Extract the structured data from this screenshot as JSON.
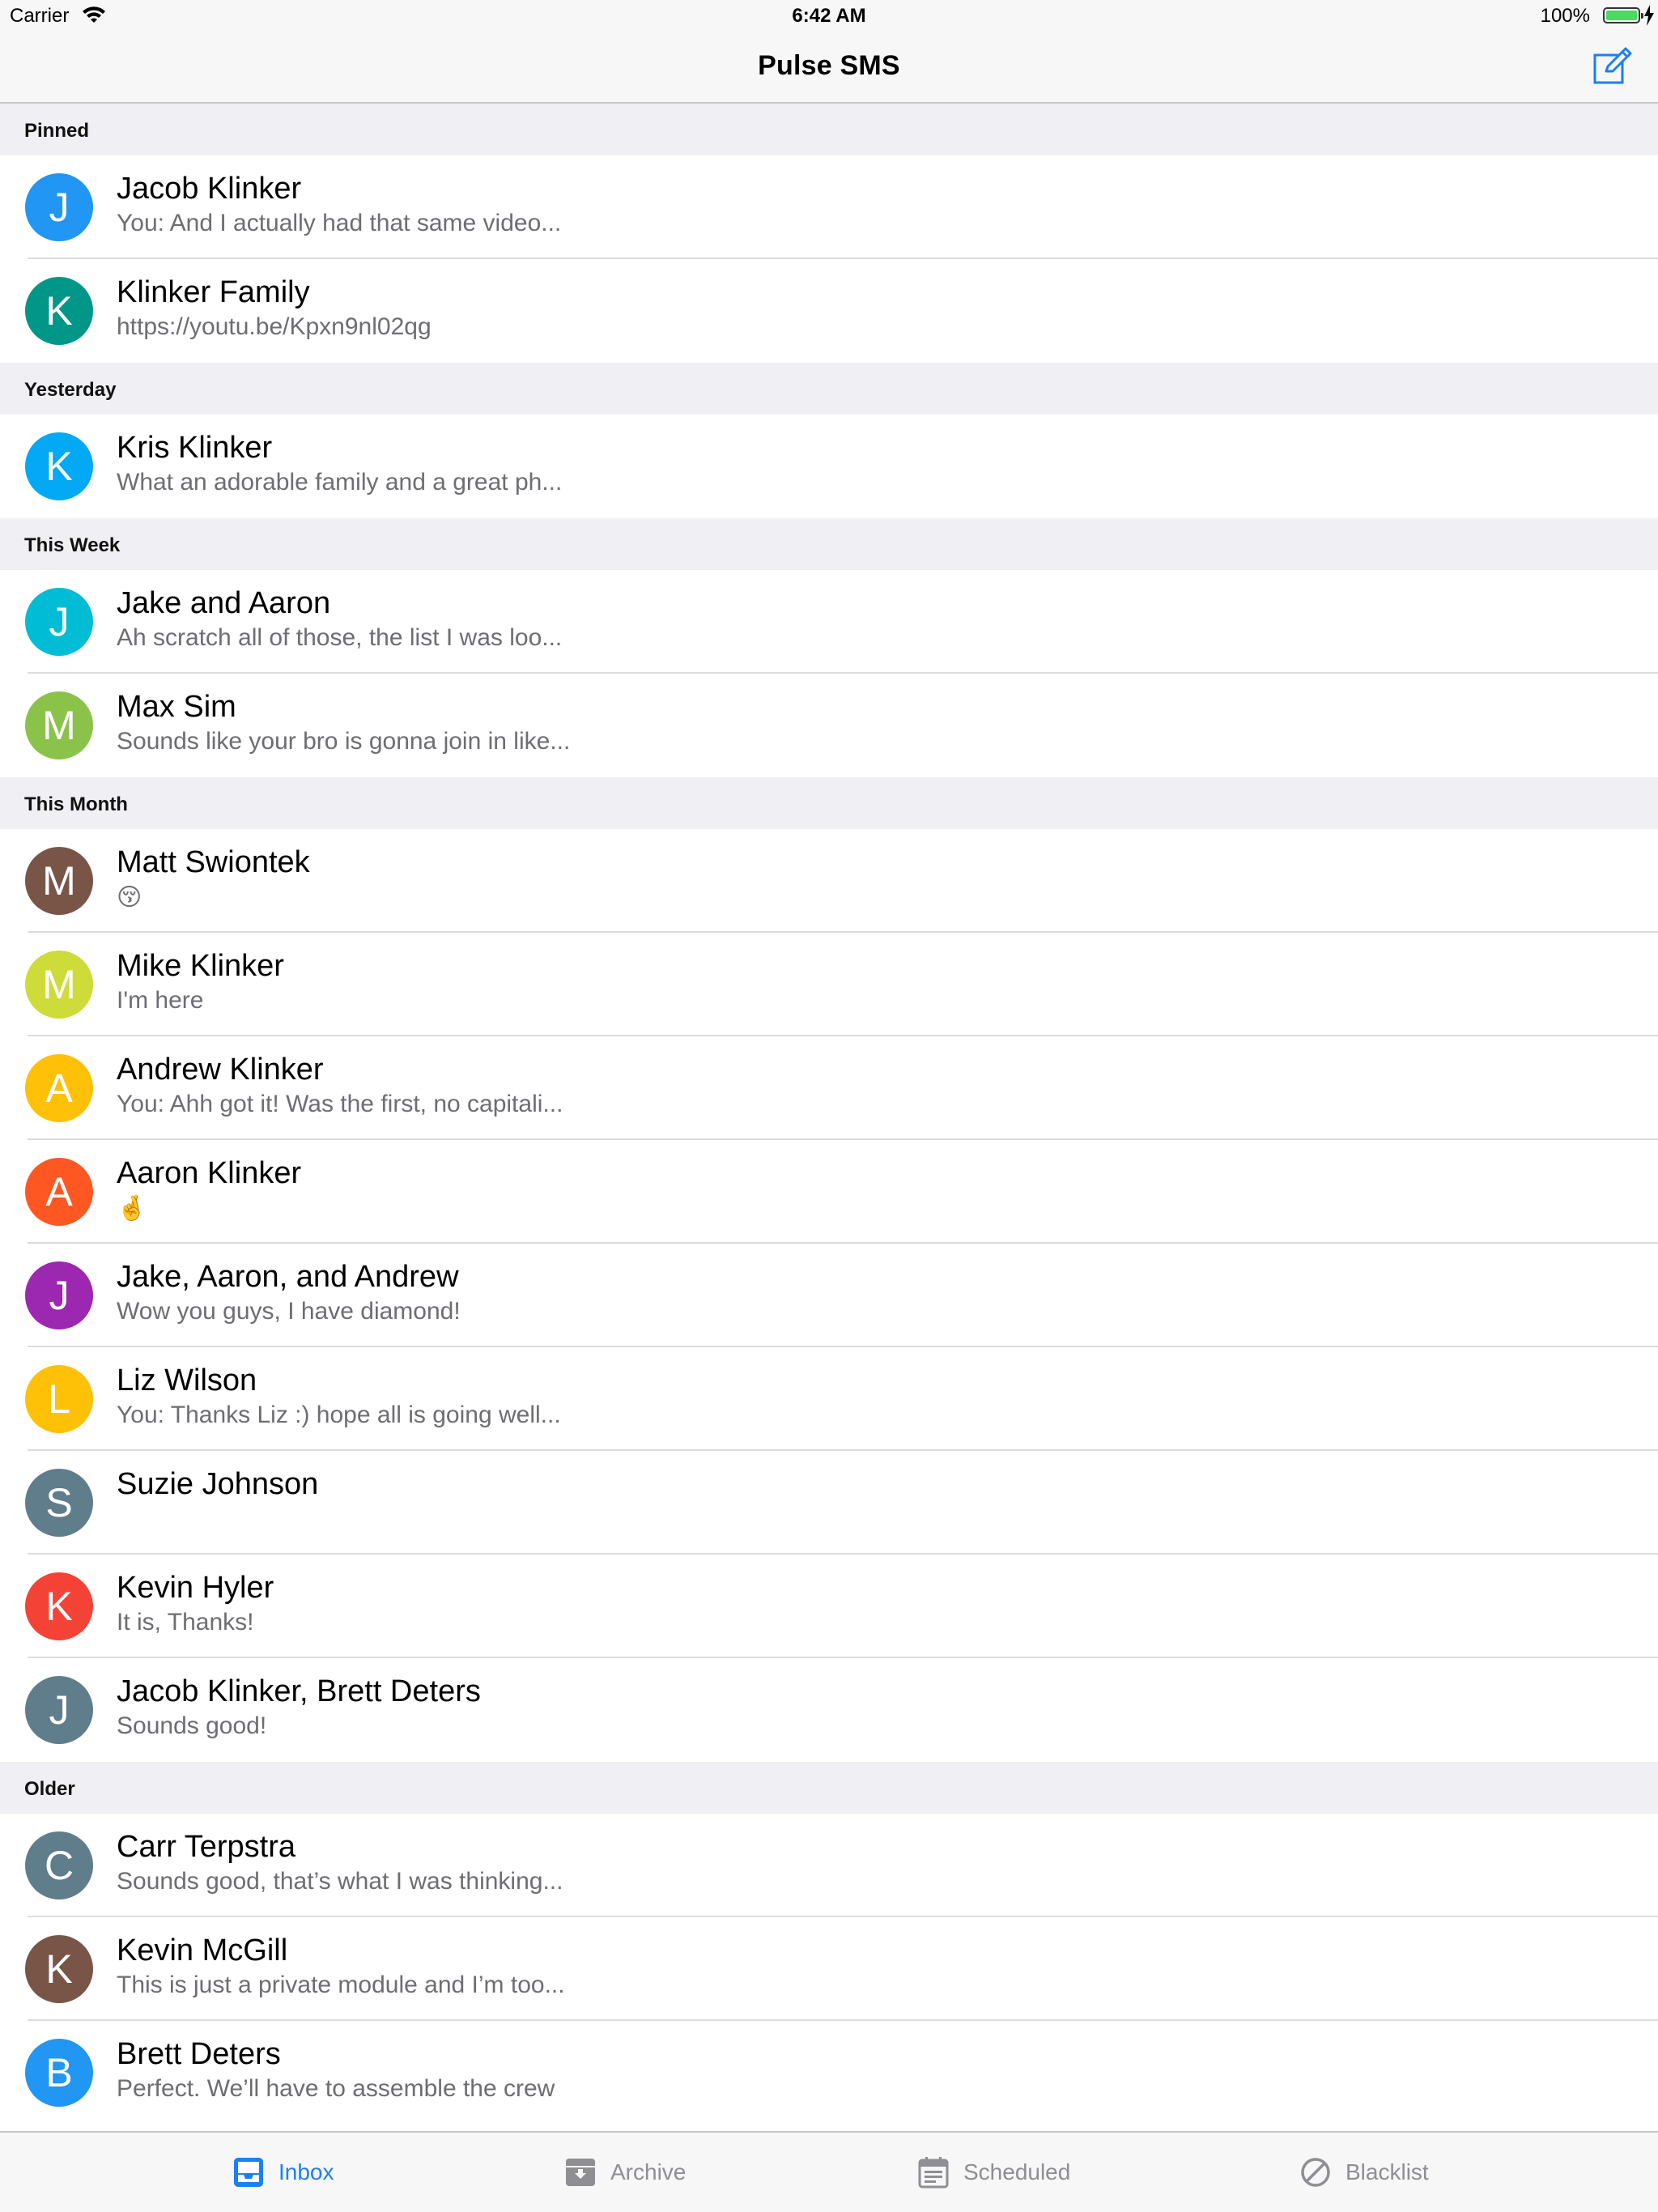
{
  "status_bar": {
    "carrier": "Carrier",
    "time": "6:42 AM",
    "battery": "100%"
  },
  "nav": {
    "title": "Pulse SMS",
    "compose_icon": "compose-icon",
    "accent": "#1b7ff7"
  },
  "sections": [
    {
      "title": "Pinned",
      "rows": [
        {
          "initial": "J",
          "name": "Jacob Klinker",
          "snippet": "You: And I actually had that same video...",
          "color": "#2196f3"
        },
        {
          "initial": "K",
          "name": "Klinker Family",
          "snippet": "https://youtu.be/Kpxn9nl02qg",
          "color": "#009688"
        }
      ]
    },
    {
      "title": "Yesterday",
      "rows": [
        {
          "initial": "K",
          "name": "Kris Klinker",
          "snippet": "What an adorable family and a great ph...",
          "color": "#03a9f4"
        }
      ]
    },
    {
      "title": "This Week",
      "rows": [
        {
          "initial": "J",
          "name": "Jake and Aaron",
          "snippet": "Ah scratch all of those, the list I was loo...",
          "color": "#00bcd4"
        },
        {
          "initial": "M",
          "name": "Max Sim",
          "snippet": "Sounds like your bro is gonna join in like...",
          "color": "#8bc34a"
        }
      ]
    },
    {
      "title": "This Month",
      "rows": [
        {
          "initial": "M",
          "name": "Matt Swiontek",
          "snippet": "😚",
          "color": "#795548"
        },
        {
          "initial": "M",
          "name": "Mike Klinker",
          "snippet": "I'm here",
          "color": "#cddc39"
        },
        {
          "initial": "A",
          "name": "Andrew Klinker",
          "snippet": "You: Ahh got it! Was the first, no capitali...",
          "color": "#ffc107"
        },
        {
          "initial": "A",
          "name": "Aaron Klinker",
          "snippet": "🤞",
          "color": "#ff5722"
        },
        {
          "initial": "J",
          "name": "Jake, Aaron, and Andrew",
          "snippet": "Wow you guys, I have diamond!",
          "color": "#9c27b0"
        },
        {
          "initial": "L",
          "name": "Liz Wilson",
          "snippet": "You: Thanks Liz :) hope all is going well...",
          "color": "#ffc107"
        },
        {
          "initial": "S",
          "name": "Suzie Johnson",
          "snippet": "",
          "color": "#607d8b"
        },
        {
          "initial": "K",
          "name": "Kevin Hyler",
          "snippet": "It is, Thanks!",
          "color": "#f44336"
        },
        {
          "initial": "J",
          "name": "Jacob Klinker, Brett Deters",
          "snippet": "Sounds good!",
          "color": "#607d8b"
        }
      ]
    },
    {
      "title": "Older",
      "rows": [
        {
          "initial": "C",
          "name": "Carr Terpstra",
          "snippet": "Sounds good, that’s what I was thinking...",
          "color": "#607d8b"
        },
        {
          "initial": "K",
          "name": "Kevin McGill",
          "snippet": "This is just a private module and I’m too...",
          "color": "#795548"
        },
        {
          "initial": "B",
          "name": "Brett Deters",
          "snippet": "Perfect. We’ll have to assemble the crew",
          "color": "#2196f3"
        }
      ]
    }
  ],
  "tabs": [
    {
      "label": "Inbox",
      "icon": "inbox-icon",
      "active": true
    },
    {
      "label": "Archive",
      "icon": "archive-icon",
      "active": false
    },
    {
      "label": "Scheduled",
      "icon": "calendar-icon",
      "active": false
    },
    {
      "label": "Blacklist",
      "icon": "blocked-icon",
      "active": false
    }
  ]
}
